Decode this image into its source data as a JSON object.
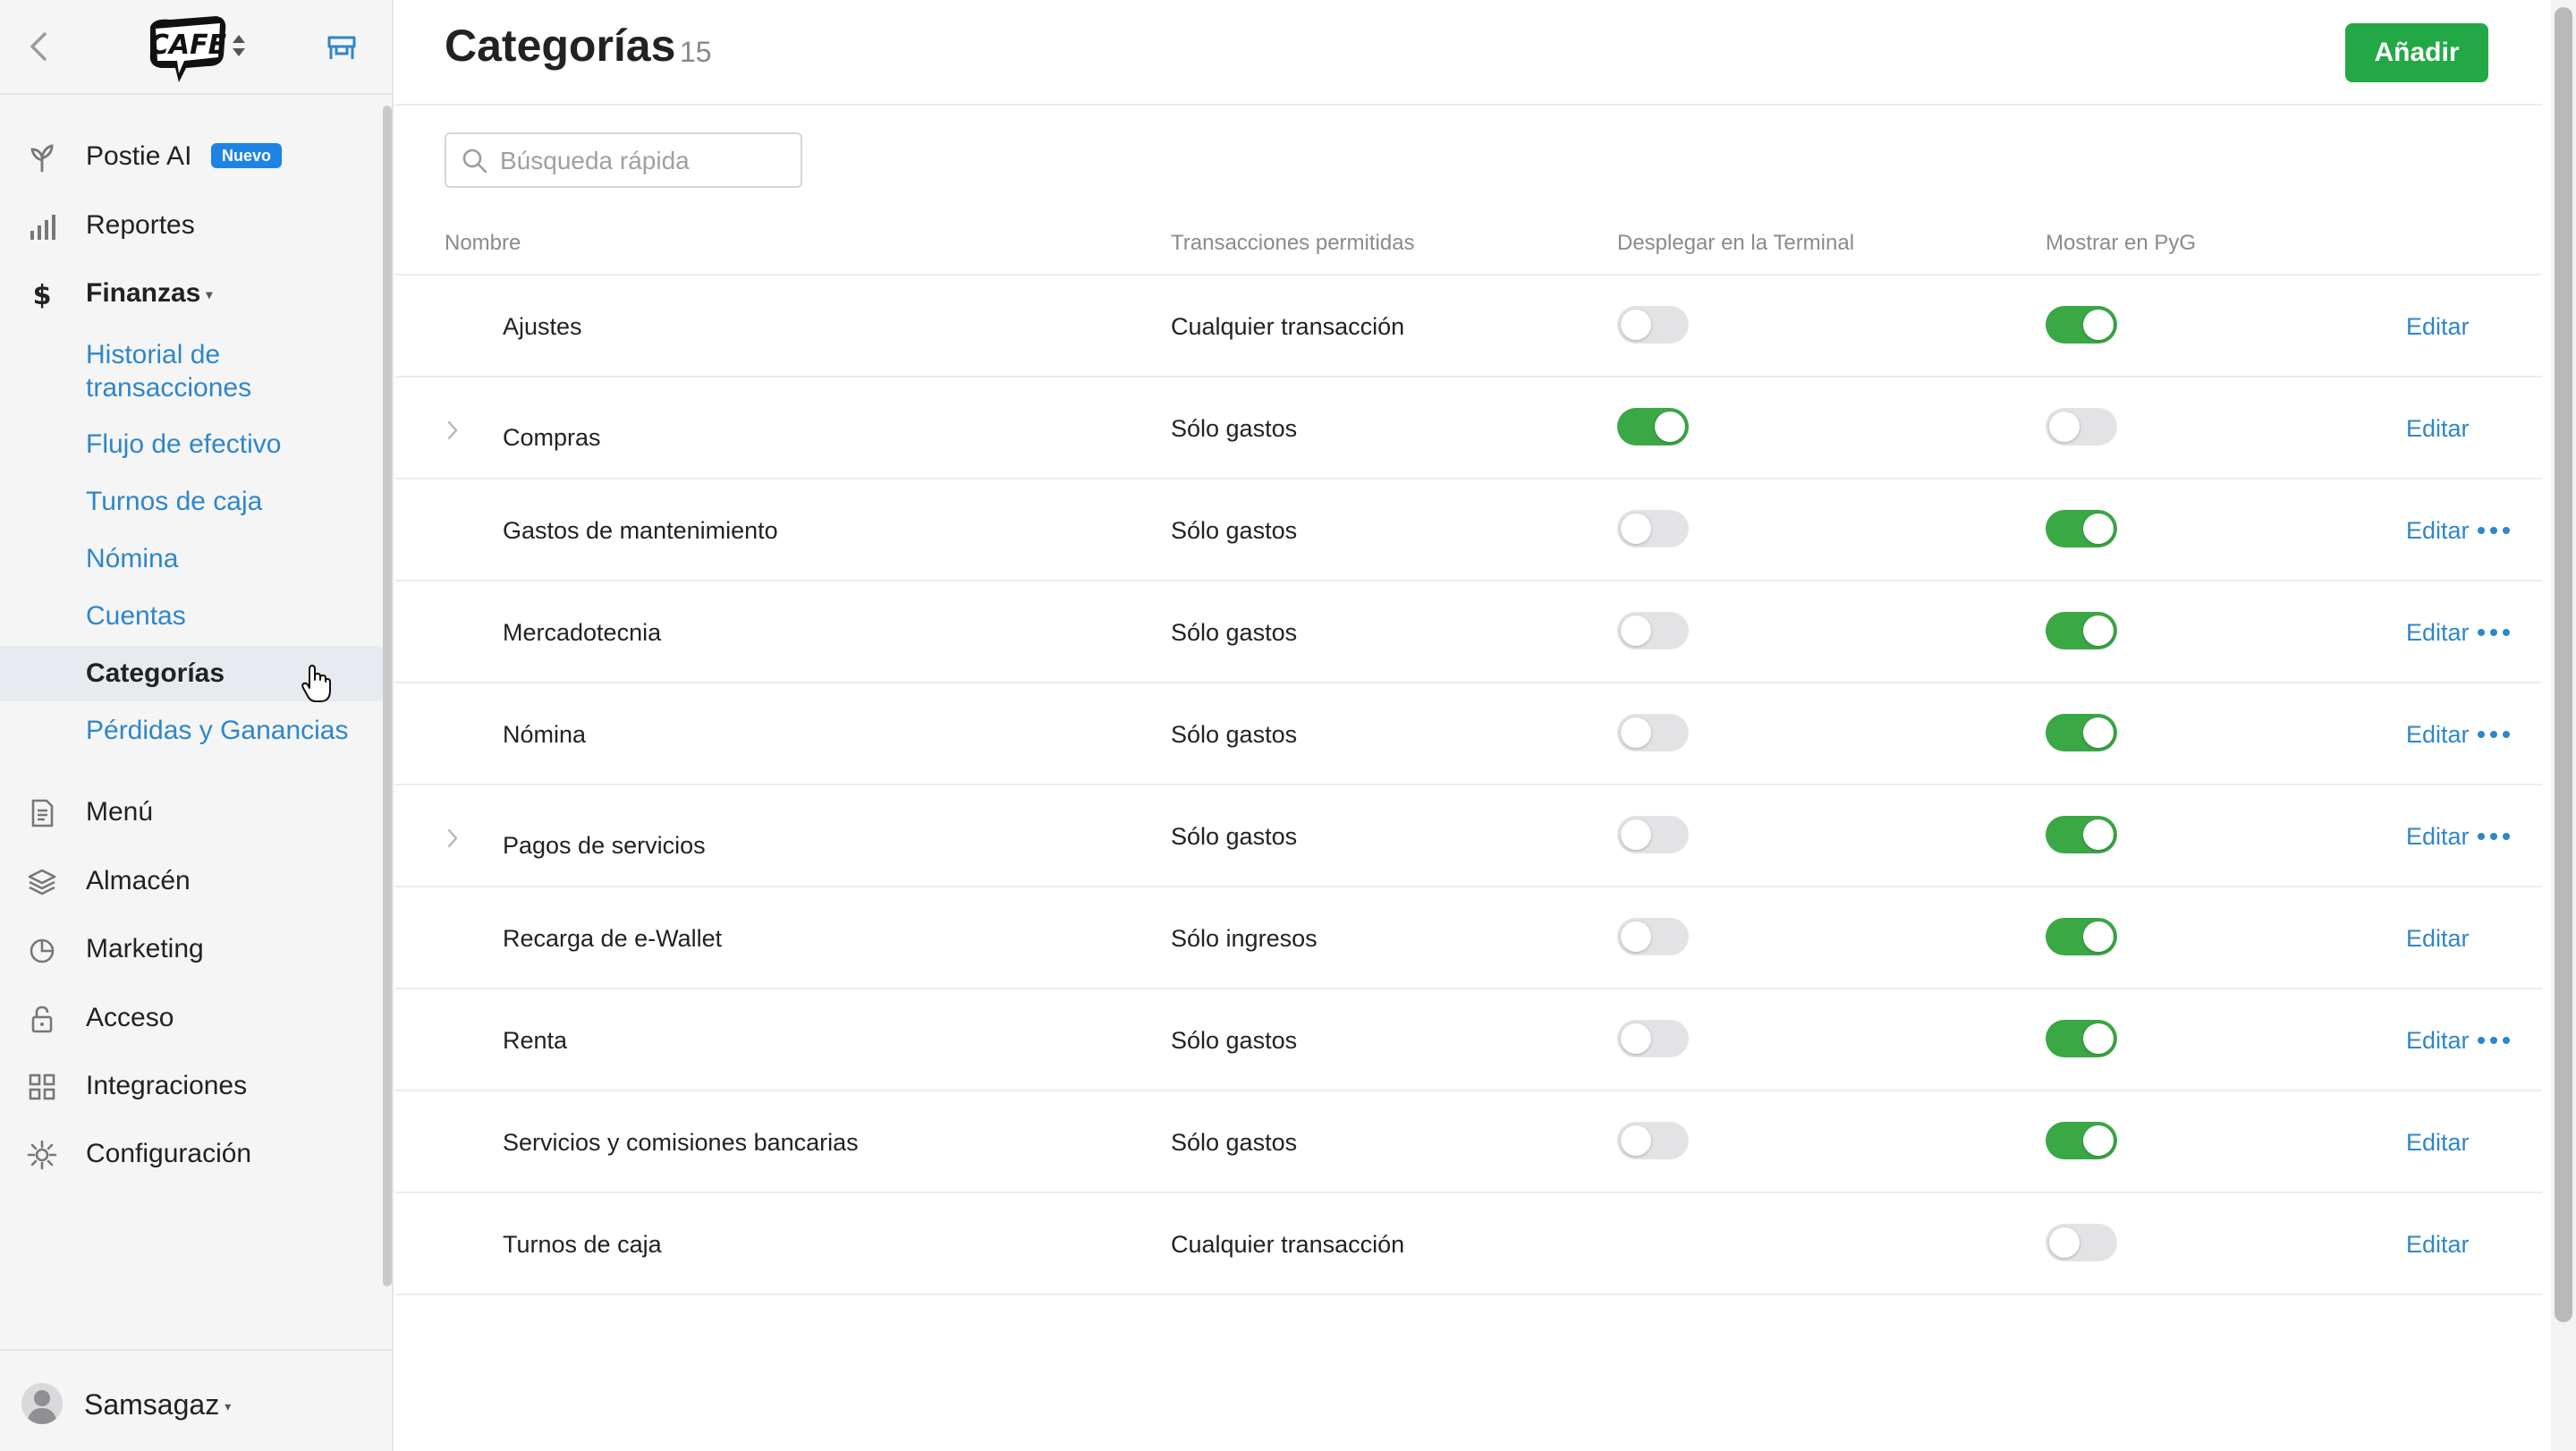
{
  "app": {
    "logo_text": "CAFE",
    "brand_color": "#22a845",
    "link_color": "#2f86c9"
  },
  "sidebar": {
    "items": [
      {
        "label": "Postie AI",
        "icon": "sprout-icon",
        "badge": "Nuevo"
      },
      {
        "label": "Reportes",
        "icon": "bar-chart-icon"
      },
      {
        "label": "Finanzas",
        "icon": "dollar-icon",
        "expanded": true
      },
      {
        "label": "Menú",
        "icon": "document-icon"
      },
      {
        "label": "Almacén",
        "icon": "layers-icon"
      },
      {
        "label": "Marketing",
        "icon": "pie-chart-icon"
      },
      {
        "label": "Acceso",
        "icon": "lock-icon"
      },
      {
        "label": "Integraciones",
        "icon": "grid-icon"
      },
      {
        "label": "Configuración",
        "icon": "gear-icon"
      }
    ],
    "finanzas_sub": [
      {
        "label": "Historial de transacciones"
      },
      {
        "label": "Flujo de efectivo"
      },
      {
        "label": "Turnos de caja"
      },
      {
        "label": "Nómina"
      },
      {
        "label": "Cuentas"
      },
      {
        "label": "Categorías",
        "active": true
      },
      {
        "label": "Pérdidas y Ganancias"
      }
    ],
    "user": {
      "name": "Samsagaz"
    }
  },
  "page": {
    "title": "Categorías",
    "count": "15",
    "add_label": "Añadir",
    "search_placeholder": "Búsqueda rápida"
  },
  "table": {
    "headers": [
      "Nombre",
      "Transacciones permitidas",
      "Desplegar en la Terminal",
      "Mostrar en PyG"
    ],
    "edit_label": "Editar",
    "rows": [
      {
        "name": "Ajustes",
        "transactions": "Cualquier transacción",
        "terminal": false,
        "pyg": true,
        "expandable": false,
        "more": false
      },
      {
        "name": "Compras",
        "transactions": "Sólo gastos",
        "terminal": true,
        "pyg": false,
        "expandable": true,
        "more": false
      },
      {
        "name": "Gastos de mantenimiento",
        "transactions": "Sólo gastos",
        "terminal": false,
        "pyg": true,
        "expandable": false,
        "more": true
      },
      {
        "name": "Mercadotecnia",
        "transactions": "Sólo gastos",
        "terminal": false,
        "pyg": true,
        "expandable": false,
        "more": true
      },
      {
        "name": "Nómina",
        "transactions": "Sólo gastos",
        "terminal": false,
        "pyg": true,
        "expandable": false,
        "more": true
      },
      {
        "name": "Pagos de servicios",
        "transactions": "Sólo gastos",
        "terminal": false,
        "pyg": true,
        "expandable": true,
        "more": true
      },
      {
        "name": "Recarga de e-Wallet",
        "transactions": "Sólo ingresos",
        "terminal": false,
        "pyg": true,
        "expandable": false,
        "more": false
      },
      {
        "name": "Renta",
        "transactions": "Sólo gastos",
        "terminal": false,
        "pyg": true,
        "expandable": false,
        "more": true
      },
      {
        "name": "Servicios y comisiones bancarias",
        "transactions": "Sólo gastos",
        "terminal": false,
        "pyg": true,
        "expandable": false,
        "more": false
      },
      {
        "name": "Turnos de caja",
        "transactions": "Cualquier transacción",
        "terminal": null,
        "pyg": false,
        "expandable": false,
        "more": false
      }
    ]
  }
}
